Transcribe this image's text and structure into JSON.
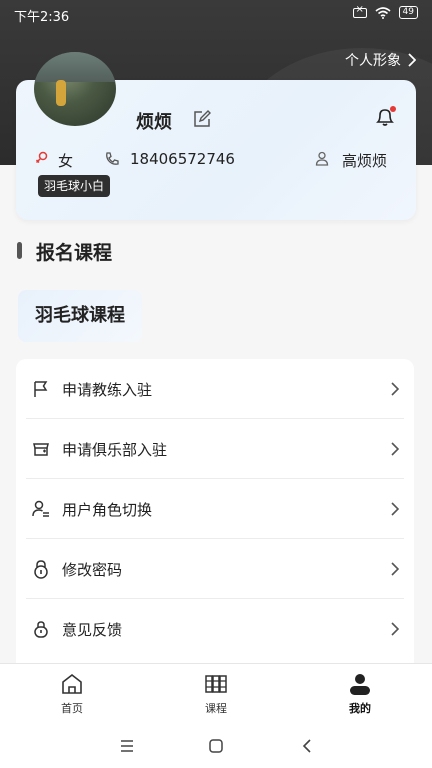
{
  "status_bar": {
    "time": "下午2:36",
    "battery": "49"
  },
  "header": {
    "profile_link": "个人形象"
  },
  "profile": {
    "username": "烦烦",
    "gender": "女",
    "phone": "18406572746",
    "real_name": "高烦烦",
    "level_badge": "羽毛球小白"
  },
  "section": {
    "title": "报名课程"
  },
  "course_tag": "羽毛球课程",
  "menu": [
    {
      "label": "申请教练入驻",
      "icon": "flag-icon"
    },
    {
      "label": "申请俱乐部入驻",
      "icon": "store-icon"
    },
    {
      "label": "用户角色切换",
      "icon": "user-switch-icon"
    },
    {
      "label": "修改密码",
      "icon": "lock-icon"
    },
    {
      "label": "意见反馈",
      "icon": "feedback-icon"
    }
  ],
  "tabs": [
    {
      "label": "首页",
      "icon": "home-icon"
    },
    {
      "label": "课程",
      "icon": "books-icon"
    },
    {
      "label": "我的",
      "icon": "profile-icon",
      "active": true
    }
  ],
  "colors": {
    "notification_dot": "#e53935",
    "gender_icon": "#e53935"
  }
}
